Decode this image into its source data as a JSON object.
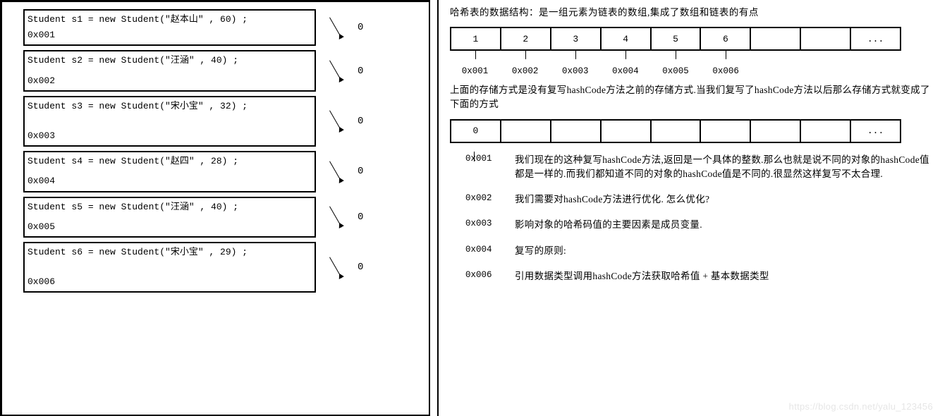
{
  "left": {
    "blocks": [
      {
        "code": "Student s1 = new Student(\"赵本山\" , 60) ;",
        "addr": "0x001",
        "val": "0"
      },
      {
        "code": "Student s2 = new Student(\"汪涵\" , 40) ;",
        "addr": "0x002",
        "val": "0"
      },
      {
        "code": "Student s3 = new Student(\"宋小宝\" , 32) ;",
        "addr": "0x003",
        "val": "0"
      },
      {
        "code": "Student s4 = new Student(\"赵四\" , 28) ;",
        "addr": "0x004",
        "val": "0"
      },
      {
        "code": "Student s5 = new Student(\"汪涵\" , 40) ;",
        "addr": "0x005",
        "val": "0"
      },
      {
        "code": "Student s6 = new Student(\"宋小宝\" , 29) ;",
        "addr": "0x006",
        "val": "0"
      }
    ]
  },
  "right": {
    "title": "哈希表的数据结构：是一组元素为链表的数组,集成了数组和链表的有点",
    "table1_cells": [
      "1",
      "2",
      "3",
      "4",
      "5",
      "6",
      "",
      "",
      "..."
    ],
    "table1_addrs": [
      "0x001",
      "0x002",
      "0x003",
      "0x004",
      "0x005",
      "0x006",
      "",
      "",
      ""
    ],
    "mid_text": "上面的存储方式是没有复写hashCode方法之前的存储方式.当我们复写了hashCode方法以后那么存储方式就变成了下面的方式",
    "table2_cells": [
      "0",
      "",
      "",
      "",
      "",
      "",
      "",
      "",
      "..."
    ],
    "chain": [
      {
        "addr": "0x001",
        "text": "我们现在的这种复写hashCode方法,返回是一个具体的整数.那么也就是说不同的对象的hashCode值都是一样的.而我们都知道不同的对象的hashCode值是不同的.很显然这样复写不太合理."
      },
      {
        "addr": "0x002",
        "text": "我们需要对hashCode方法进行优化. 怎么优化?"
      },
      {
        "addr": "0x003",
        "text": "影响对象的哈希码值的主要因素是成员变量."
      },
      {
        "addr": "0x004",
        "text": "复写的原则:"
      },
      {
        "addr": "0x006",
        "text": "引用数据类型调用hashCode方法获取哈希值 + 基本数据类型"
      }
    ],
    "watermark": "https://blog.csdn.net/yalu_123456"
  }
}
